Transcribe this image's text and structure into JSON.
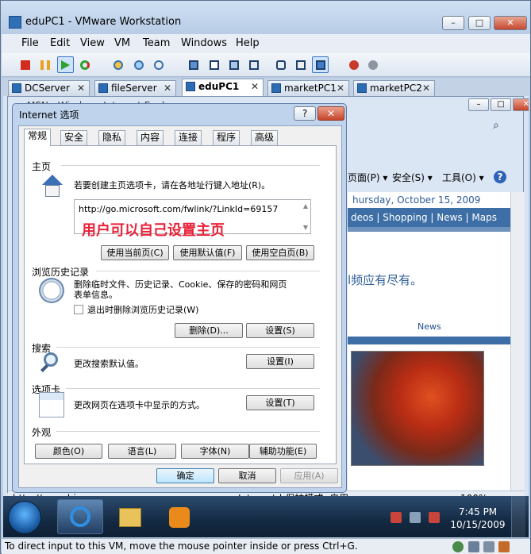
{
  "window": {
    "title": "eduPC1 - VMware Workstation",
    "minimize_glyph": "–",
    "maximize_glyph": "□",
    "close_glyph": "✕"
  },
  "menu": [
    "File",
    "Edit",
    "View",
    "VM",
    "Team",
    "Windows",
    "Help"
  ],
  "toolbar_icons": [
    "power-off-icon",
    "suspend-icon",
    "power-on-icon",
    "reset-icon",
    "snapshot-icon",
    "revert-snapshot-icon",
    "snapshot-manager-icon",
    "full-screen-icon",
    "quick-switch-icon",
    "summary-view-icon",
    "console-view-icon",
    "appliance-view-icon",
    "unity-icon",
    "show-console-icon",
    "thumbnail-icon"
  ],
  "tabs": [
    {
      "label": "DCServer",
      "active": false
    },
    {
      "label": "fileServer",
      "active": false
    },
    {
      "label": "eduPC1",
      "active": true
    },
    {
      "label": "marketPC1",
      "active": false
    },
    {
      "label": "marketPC2",
      "active": false
    }
  ],
  "tab_close_glyph": "✕",
  "ie": {
    "title_partial": "MSN - Windows Internet Explorer",
    "search_glyph": "⌕",
    "command_items": [
      "页面(P) ▾",
      "安全(S) ▾",
      "工具(O) ▾"
    ],
    "help_glyph": "?",
    "page": {
      "date": "hursday, October 15, 2009",
      "nav": "deos | Shopping | News | Maps",
      "promo": "l频应有尽有。",
      "news_link": "News"
    },
    "status_url": "http://www.bing.com",
    "status_zone": "Internet | 保护模式: 启用",
    "zoom": "100%"
  },
  "dialog": {
    "title": "Internet 选项",
    "help_glyph": "?",
    "close_glyph": "✕",
    "tabs": [
      "常规",
      "安全",
      "隐私",
      "内容",
      "连接",
      "程序",
      "高级"
    ],
    "home": {
      "heading": "主页",
      "desc": "若要创建主页选项卡，请在各地址行键入地址(R)。",
      "url": "http://go.microsoft.com/fwlink/?LinkId=69157",
      "annotation": "用户可以自己设置主页",
      "buttons": [
        "使用当前页(C)",
        "使用默认值(F)",
        "使用空白页(B)"
      ]
    },
    "history": {
      "heading": "浏览历史记录",
      "desc_line1": "删除临时文件、历史记录、Cookie、保存的密码和网页",
      "desc_line2": "表单信息。",
      "checkbox": "退出时删除浏览历史记录(W)",
      "buttons": [
        "删除(D)...",
        "设置(S)"
      ]
    },
    "search": {
      "heading": "搜索",
      "desc": "更改搜索默认值。",
      "button": "设置(I)"
    },
    "tabs_section": {
      "heading": "选项卡",
      "desc": "更改网页在选项卡中显示的方式。",
      "button": "设置(T)"
    },
    "appearance": {
      "heading": "外观",
      "buttons": [
        "颜色(O)",
        "语言(L)",
        "字体(N)",
        "辅助功能(E)"
      ]
    },
    "footer": [
      "确定",
      "取消",
      "应用(A)"
    ]
  },
  "taskbar": {
    "time": "7:45 PM",
    "date": "10/15/2009"
  },
  "statusbar": "To direct input to this VM, move the mouse pointer inside or press Ctrl+G."
}
